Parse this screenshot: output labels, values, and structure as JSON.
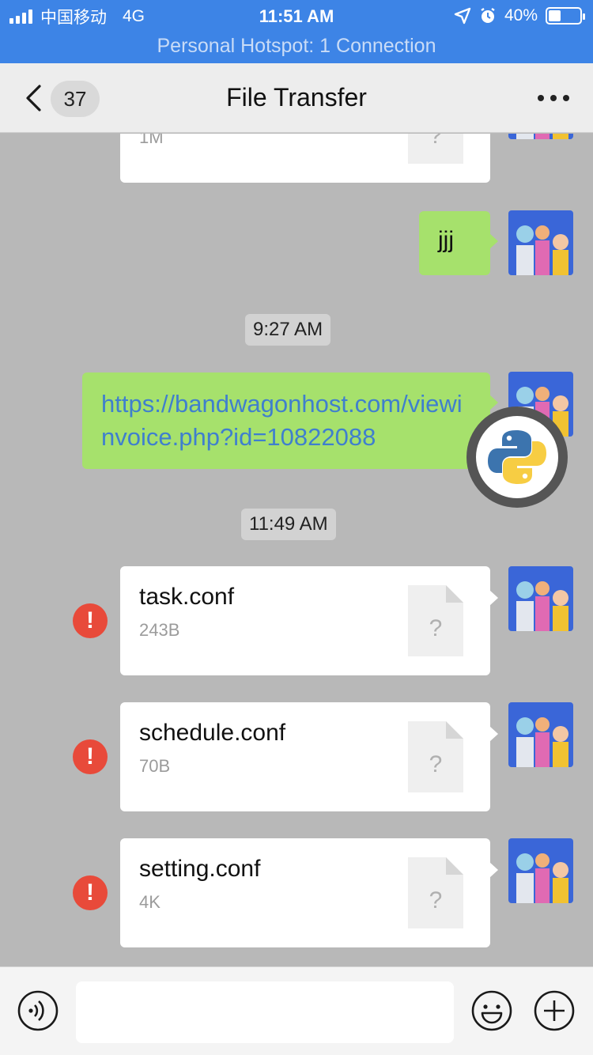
{
  "status_bar": {
    "carrier": "中国移动",
    "network": "4G",
    "time": "11:51 AM",
    "battery_percent": "40%",
    "battery_level": 0.4,
    "hotspot": "Personal Hotspot: 1 Connection"
  },
  "nav": {
    "unread_count": "37",
    "title": "File Transfer"
  },
  "messages": [
    {
      "type": "file",
      "name": "",
      "size": "1M",
      "status": "sent"
    },
    {
      "type": "text",
      "text": "jjj"
    },
    {
      "type": "timestamp",
      "text": "9:27 AM"
    },
    {
      "type": "link",
      "text": "https://bandwagonhost.com/viewinvoice.php?id=10822088"
    },
    {
      "type": "timestamp",
      "text": "11:49 AM"
    },
    {
      "type": "file",
      "name": "task.conf",
      "size": "243B",
      "status": "failed",
      "error_glyph": "!"
    },
    {
      "type": "file",
      "name": "schedule.conf",
      "size": "70B",
      "status": "failed",
      "error_glyph": "!"
    },
    {
      "type": "file",
      "name": "setting.conf",
      "size": "4K",
      "status": "failed",
      "error_glyph": "!"
    }
  ],
  "file_placeholder_glyph": "?",
  "input": {
    "value": "",
    "placeholder": ""
  },
  "icons": {
    "voice": "voice-icon",
    "emoji": "emoji-icon",
    "plus": "plus-icon",
    "floating": "python-logo-icon"
  },
  "colors": {
    "status_bar": "#3d84e6",
    "sent_bubble": "#a6e16c",
    "link": "#3f7fce",
    "error": "#e84a3a"
  }
}
